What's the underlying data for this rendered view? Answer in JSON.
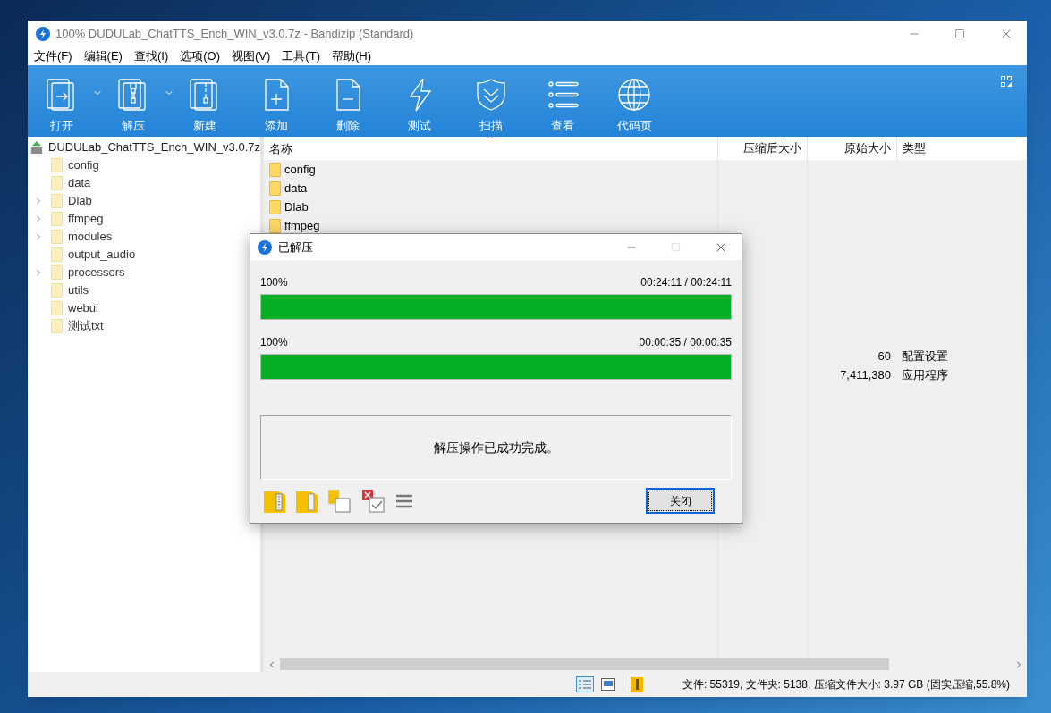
{
  "window": {
    "title": "100% DUDULab_ChatTTS_Ench_WIN_v3.0.7z - Bandizip (Standard)"
  },
  "menu": [
    "文件(F)",
    "编辑(E)",
    "查找(I)",
    "选项(O)",
    "视图(V)",
    "工具(T)",
    "帮助(H)"
  ],
  "toolbar": [
    {
      "label": "打开",
      "dropdown": true
    },
    {
      "label": "解压",
      "dropdown": true
    },
    {
      "label": "新建",
      "dropdown": false
    },
    {
      "label": "添加",
      "dropdown": false
    },
    {
      "label": "删除",
      "dropdown": false
    },
    {
      "label": "测试",
      "dropdown": false
    },
    {
      "label": "扫描",
      "dropdown": false
    },
    {
      "label": "查看",
      "dropdown": false
    },
    {
      "label": "代码页",
      "dropdown": false
    }
  ],
  "tree": {
    "root": "DUDULab_ChatTTS_Ench_WIN_v3.0.7z",
    "children": [
      {
        "name": "config",
        "expandable": false
      },
      {
        "name": "data",
        "expandable": false
      },
      {
        "name": "Dlab",
        "expandable": true
      },
      {
        "name": "ffmpeg",
        "expandable": true
      },
      {
        "name": "modules",
        "expandable": true
      },
      {
        "name": "output_audio",
        "expandable": false
      },
      {
        "name": "processors",
        "expandable": true
      },
      {
        "name": "utils",
        "expandable": false
      },
      {
        "name": "webui",
        "expandable": false
      },
      {
        "name": "测试txt",
        "expandable": false
      }
    ]
  },
  "list": {
    "columns": [
      "名称",
      "压缩后大小",
      "原始大小",
      "类型"
    ],
    "rows": [
      {
        "name": "config"
      },
      {
        "name": "data"
      },
      {
        "name": "Dlab"
      },
      {
        "name": "ffmpeg"
      },
      {
        "original_size": "60",
        "type": "配置设置"
      },
      {
        "original_size": "7,411,380",
        "type": "应用程序"
      }
    ]
  },
  "dialog": {
    "title": "已解压",
    "progress": [
      {
        "percent": "100%",
        "time": "00:24:11 / 00:24:11",
        "level": 1
      },
      {
        "percent": "100%",
        "time": "00:00:35 / 00:00:35",
        "level": 1
      }
    ],
    "message": "解压操作已成功完成。",
    "close_button": "关闭"
  },
  "status_bar": "文件: 55319, 文件夹: 5138, 压缩文件大小: 3.97 GB (固实压缩,55.8%)"
}
